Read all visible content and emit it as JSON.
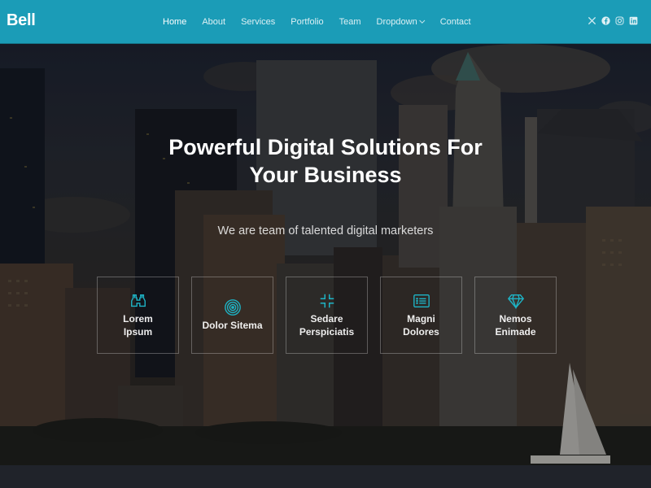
{
  "header": {
    "logo": "Bell",
    "nav": [
      {
        "label": "Home",
        "active": true
      },
      {
        "label": "About"
      },
      {
        "label": "Services"
      },
      {
        "label": "Portfolio"
      },
      {
        "label": "Team"
      },
      {
        "label": "Dropdown",
        "has_dropdown": true
      },
      {
        "label": "Contact"
      }
    ],
    "social": [
      "x-twitter-icon",
      "facebook-icon",
      "instagram-icon",
      "linkedin-icon"
    ]
  },
  "hero": {
    "title": "Powerful Digital Solutions For Your Business",
    "subtitle": "We are team of talented digital marketers",
    "features": [
      {
        "icon": "binoculars-icon",
        "title": "Lorem Ipsum"
      },
      {
        "icon": "bullseye-icon",
        "title": "Dolor Sitema"
      },
      {
        "icon": "fullscreen-exit-icon",
        "title": "Sedare Perspiciatis"
      },
      {
        "icon": "card-list-icon",
        "title": "Magni Dolores"
      },
      {
        "icon": "gem-icon",
        "title": "Nemos Enimade"
      }
    ]
  },
  "colors": {
    "header_bg": "#1b9cb7",
    "accent": "#1eb4c6",
    "text": "#ffffff"
  }
}
